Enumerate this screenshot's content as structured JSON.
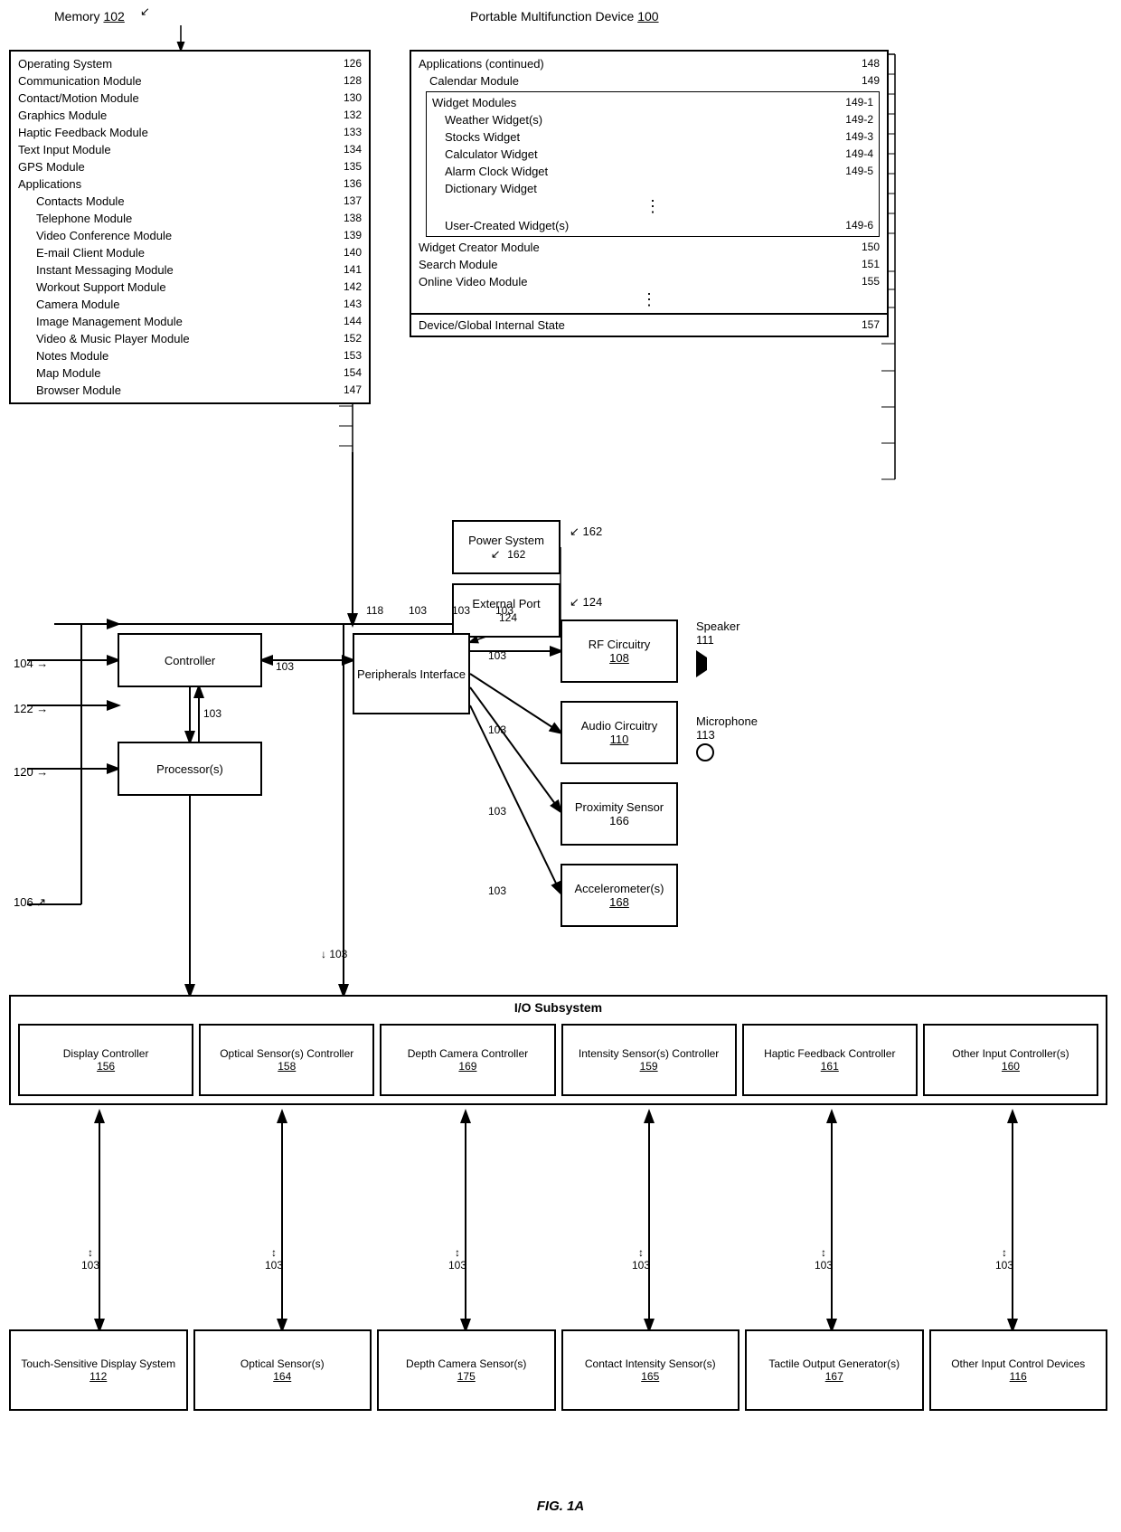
{
  "title": "FIG. 1A",
  "memory": {
    "label": "Memory",
    "ref": "102",
    "items": [
      {
        "label": "Operating System",
        "ref": "126"
      },
      {
        "label": "Communication Module",
        "ref": "128"
      },
      {
        "label": "Contact/Motion Module",
        "ref": "130"
      },
      {
        "label": "Graphics Module",
        "ref": "132"
      },
      {
        "label": "Haptic Feedback Module",
        "ref": "133"
      },
      {
        "label": "Text Input Module",
        "ref": "134"
      },
      {
        "label": "GPS Module",
        "ref": "135"
      },
      {
        "label": "Applications",
        "ref": "136"
      },
      {
        "label": "Contacts Module",
        "ref": "137",
        "indent": true
      },
      {
        "label": "Telephone Module",
        "ref": "138",
        "indent": true
      },
      {
        "label": "Video Conference Module",
        "ref": "139",
        "indent": true
      },
      {
        "label": "E-mail Client Module",
        "ref": "140",
        "indent": true
      },
      {
        "label": "Instant Messaging Module",
        "ref": "141",
        "indent": true
      },
      {
        "label": "Workout Support Module",
        "ref": "142",
        "indent": true
      },
      {
        "label": "Camera Module",
        "ref": "143",
        "indent": true
      },
      {
        "label": "Image Management Module",
        "ref": "144",
        "indent": true
      },
      {
        "label": "Video & Music Player Module",
        "ref": "152",
        "indent": true
      },
      {
        "label": "Notes Module",
        "ref": "153",
        "indent": true
      },
      {
        "label": "Map Module",
        "ref": "154",
        "indent": true
      },
      {
        "label": "Browser Module",
        "ref": "147",
        "indent": true
      }
    ]
  },
  "pmd": {
    "label": "Portable Multifunction Device",
    "ref": "100",
    "items": [
      {
        "label": "Applications (continued)",
        "ref": "148"
      },
      {
        "label": "Calendar Module",
        "ref": "149"
      },
      {
        "label": "Widget Modules",
        "ref": "149-1"
      },
      {
        "label": "Weather Widget(s)",
        "ref": "149-2",
        "indent": true
      },
      {
        "label": "Stocks Widget",
        "ref": "149-3",
        "indent": true
      },
      {
        "label": "Calculator Widget",
        "ref": "149-4",
        "indent": true
      },
      {
        "label": "Alarm Clock Widget",
        "ref": "149-5",
        "indent": true
      },
      {
        "label": "Dictionary Widget",
        "ref": "",
        "indent": true
      },
      {
        "label": "User-Created Widget(s)",
        "ref": "149-6",
        "indent": true
      },
      {
        "label": "Widget Creator Module",
        "ref": "150"
      },
      {
        "label": "Search Module",
        "ref": "151"
      },
      {
        "label": "Online Video Module",
        "ref": "155"
      },
      {
        "label": "Device/Global Internal State",
        "ref": "157"
      }
    ]
  },
  "peripherals_interface": "Peripherals Interface",
  "controller": "Controller",
  "processors": "Processor(s)",
  "rf_circuitry": {
    "label": "RF Circuitry",
    "ref": "108"
  },
  "audio_circuitry": {
    "label": "Audio Circuitry",
    "ref": "110"
  },
  "proximity_sensor": {
    "label": "Proximity Sensor",
    "ref": "166"
  },
  "accelerometers": {
    "label": "Accelerometer(s)",
    "ref": "168"
  },
  "power_system": {
    "label": "Power System",
    "ref": "162"
  },
  "external_port": {
    "label": "External Port",
    "ref": "124"
  },
  "speaker": {
    "label": "Speaker",
    "ref": "111"
  },
  "microphone": {
    "label": "Microphone",
    "ref": "113"
  },
  "io_subsystem": "I/O Subsystem",
  "io_items": [
    {
      "label": "Display Controller",
      "ref": "156"
    },
    {
      "label": "Optical Sensor(s) Controller",
      "ref": "158"
    },
    {
      "label": "Depth Camera Controller",
      "ref": "169"
    },
    {
      "label": "Intensity Sensor(s) Controller",
      "ref": "159"
    },
    {
      "label": "Haptic Feedback Controller",
      "ref": "161"
    },
    {
      "label": "Other Input Controller(s)",
      "ref": "160"
    }
  ],
  "bottom_items": [
    {
      "label": "Touch-Sensitive Display System",
      "ref": "112"
    },
    {
      "label": "Optical Sensor(s)",
      "ref": "164"
    },
    {
      "label": "Depth Camera Sensor(s)",
      "ref": "175"
    },
    {
      "label": "Contact Intensity Sensor(s)",
      "ref": "165"
    },
    {
      "label": "Tactile Output Generator(s)",
      "ref": "167"
    },
    {
      "label": "Other Input Control Devices",
      "ref": "116"
    }
  ],
  "ref_labels": {
    "103_periph": "103",
    "103_rf": "103",
    "103_audio": "103",
    "103_prox": "103",
    "103_accel": "103",
    "104": "104",
    "106": "106",
    "118": "118",
    "120": "120",
    "122": "122"
  },
  "fig_caption": "FIG. 1A"
}
